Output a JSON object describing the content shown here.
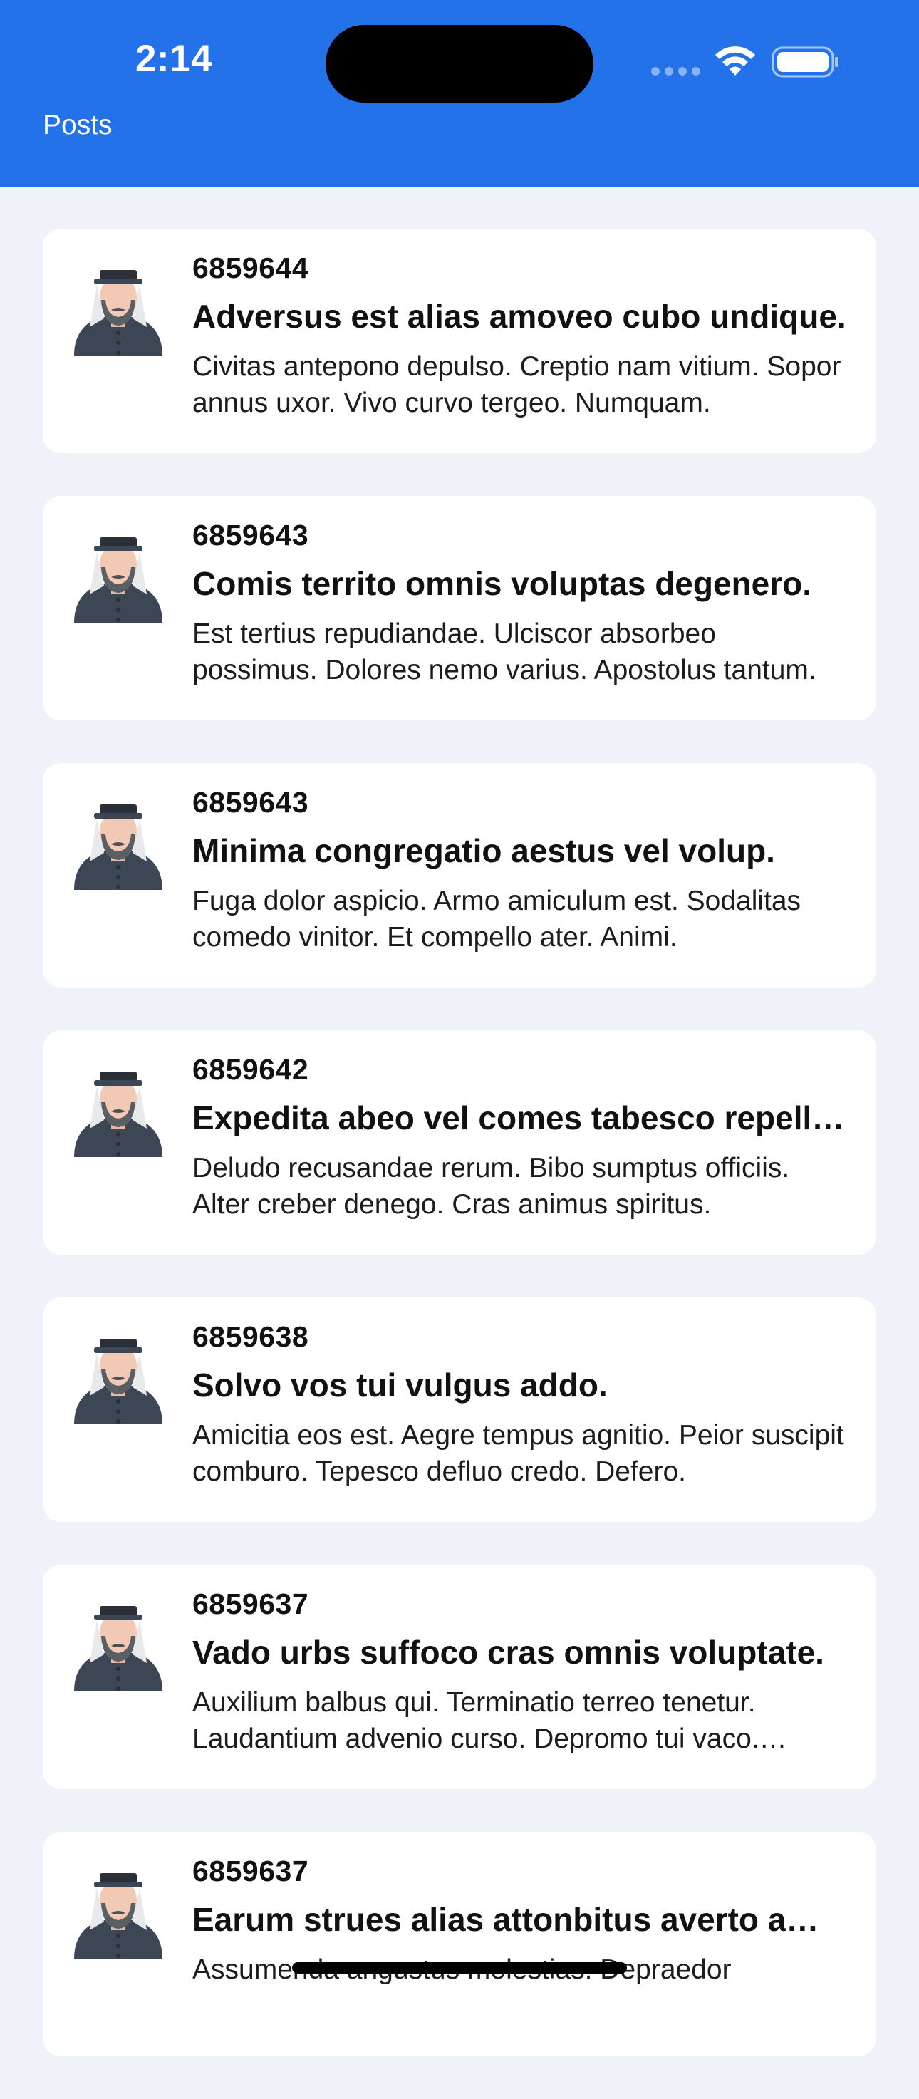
{
  "status_bar": {
    "time": "2:14"
  },
  "header": {
    "title": "Posts",
    "color": "#2472e9"
  },
  "posts": [
    {
      "id": "6859644",
      "title": "Adversus est alias amoveo cubo undique.",
      "body": "Civitas antepono depulso. Creptio nam vitium. Sopor annus uxor. Vivo curvo tergeo. Numquam."
    },
    {
      "id": "6859643",
      "title": "Comis territo omnis voluptas degenero.",
      "body": "Est tertius repudiandae. Ulciscor absorbeo possimus. Dolores nemo varius. Apostolus tantum."
    },
    {
      "id": "6859643",
      "title": "Minima congregatio aestus vel volup.",
      "body": "Fuga dolor aspicio. Armo amiculum est. Sodalitas comedo vinitor. Et compello ater. Animi."
    },
    {
      "id": "6859642",
      "title": "Expedita abeo vel comes tabesco repellat.",
      "body": "Deludo recusandae rerum. Bibo sumptus officiis. Alter creber denego. Cras animus spiritus."
    },
    {
      "id": "6859638",
      "title": "Solvo vos tui vulgus addo.",
      "body": "Amicitia eos est. Aegre tempus agnitio. Peior suscipit comburo. Tepesco defluo credo. Defero."
    },
    {
      "id": "6859637",
      "title": "Vado urbs suffoco cras omnis voluptate.",
      "body": "Auxilium balbus qui. Terminatio terreo tenetur. Laudantium advenio curso. Depromo tui vaco. Abbas."
    },
    {
      "id": "6859637",
      "title": "Earum strues alias attonbitus averto amet.",
      "body": "Assumenda angustus molestias. Depraedor"
    }
  ]
}
